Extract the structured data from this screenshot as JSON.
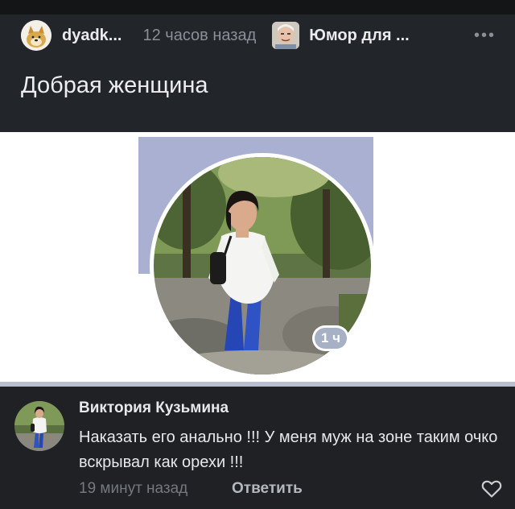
{
  "post": {
    "author": "dyadk...",
    "time": "12 часов назад",
    "community": "Юмор для ...",
    "more": "•••",
    "title": "Добрая женщина"
  },
  "image": {
    "badge": "1 ч"
  },
  "comment": {
    "author": "Виктория Кузьмина",
    "text": "Наказать его анально !!! У меня муж на зоне таким очко вскрывал как орехи !!!",
    "time": "19 минут назад",
    "reply_label": "Ответить"
  },
  "colors": {
    "background": "#1f2124",
    "cover": "#a9b0d1",
    "accent_muted": "#8b9096"
  },
  "icons": [
    "doge-avatar-icon",
    "community-avatar-icon",
    "more-icon",
    "heart-icon"
  ]
}
